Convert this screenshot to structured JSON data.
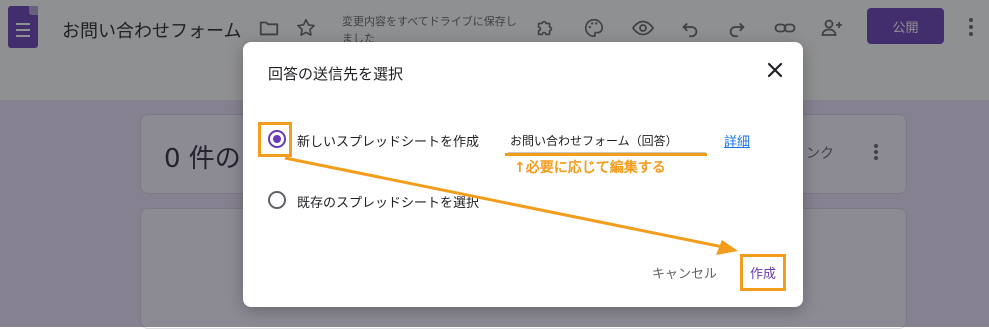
{
  "app": {
    "title": "お問い合わせフォーム",
    "save_status": "変更内容をすべてドライブに保存しました",
    "publish_label": "公開",
    "brand_color": "#673ab7"
  },
  "toolbar_icons": [
    "folder-icon",
    "star-icon",
    "puzzle-addon-icon",
    "palette-icon",
    "eye-preview-icon",
    "undo-icon",
    "redo-icon",
    "link-icon",
    "add-person-icon",
    "more-vert-icon"
  ],
  "responses_card": {
    "count_text": "0 件の",
    "link_label": "ンク"
  },
  "dialog": {
    "title": "回答の送信先を選択",
    "option_new": "新しいスプレッドシートを作成",
    "option_existing": "既存のスプレッドシートを選択",
    "selected_option": "new",
    "sheet_name": "お問い合わせフォーム（回答）",
    "details_link": "詳細",
    "cancel_label": "キャンセル",
    "create_label": "作成"
  },
  "annotation": {
    "note": "↑必要に応じて編集する",
    "highlight_color": "#f29d1c"
  }
}
